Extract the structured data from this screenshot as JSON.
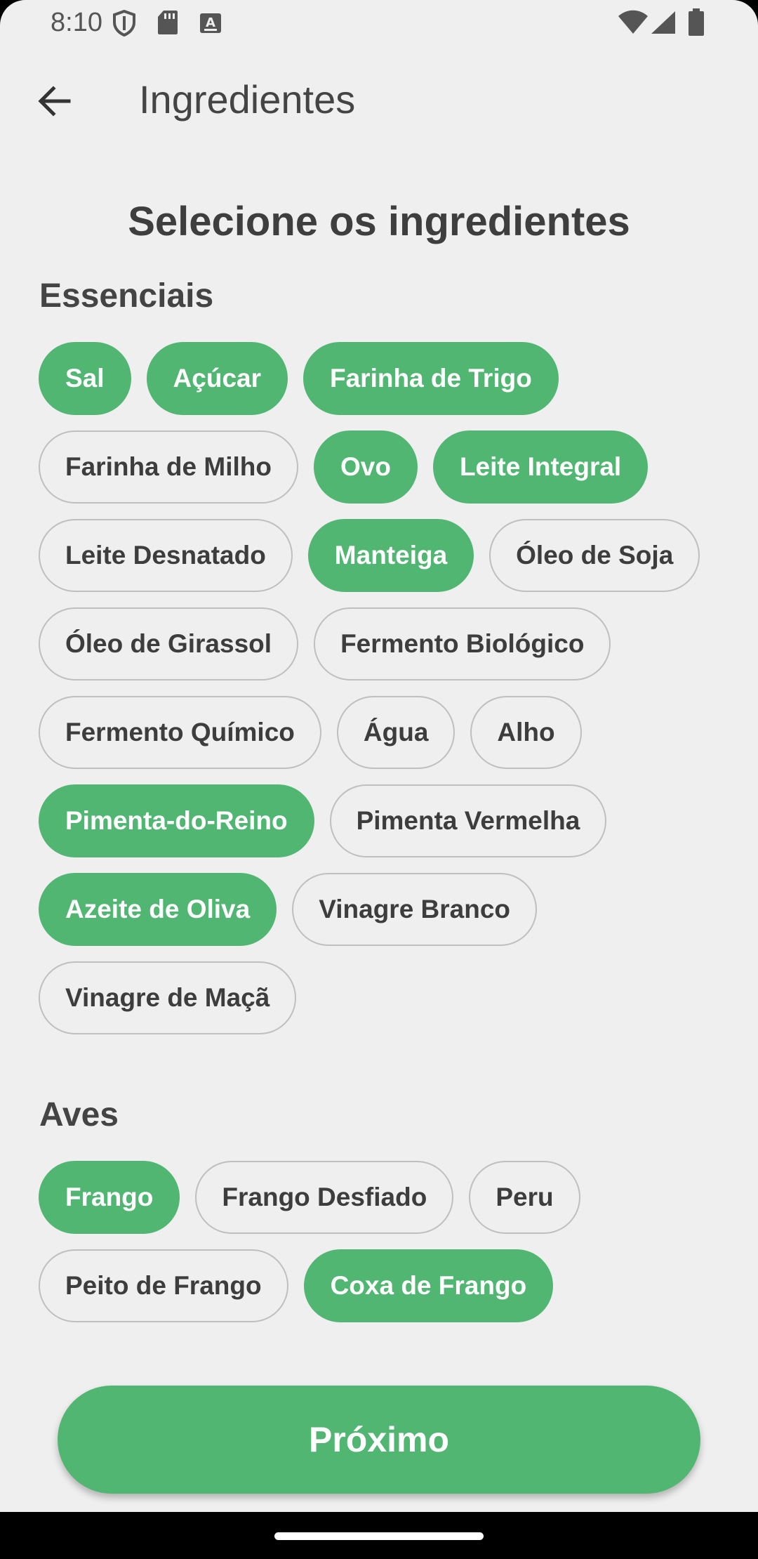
{
  "status_bar": {
    "time": "8:10",
    "icons": [
      "shield-icon",
      "sd-card-icon",
      "keyboard-a-icon",
      "wifi-icon",
      "signal-icon",
      "battery-icon"
    ]
  },
  "app_bar": {
    "back_icon": "arrow-back-icon",
    "title": "Ingredientes"
  },
  "heading": "Selecione os ingredientes",
  "sections": [
    {
      "title": "Essenciais",
      "chips": [
        {
          "label": "Sal",
          "selected": true
        },
        {
          "label": "Açúcar",
          "selected": true
        },
        {
          "label": "Farinha de Trigo",
          "selected": true
        },
        {
          "label": "Farinha de Milho",
          "selected": false
        },
        {
          "label": "Ovo",
          "selected": true
        },
        {
          "label": "Leite Integral",
          "selected": true
        },
        {
          "label": "Leite Desnatado",
          "selected": false
        },
        {
          "label": "Manteiga",
          "selected": true
        },
        {
          "label": "Óleo de Soja",
          "selected": false
        },
        {
          "label": "Óleo de Girassol",
          "selected": false
        },
        {
          "label": "Fermento Biológico",
          "selected": false
        },
        {
          "label": "Fermento Químico",
          "selected": false
        },
        {
          "label": "Água",
          "selected": false
        },
        {
          "label": "Alho",
          "selected": false
        },
        {
          "label": "Pimenta-do-Reino",
          "selected": true
        },
        {
          "label": "Pimenta Vermelha",
          "selected": false
        },
        {
          "label": "Azeite de Oliva",
          "selected": true
        },
        {
          "label": "Vinagre Branco",
          "selected": false
        },
        {
          "label": "Vinagre de Maçã",
          "selected": false
        }
      ]
    },
    {
      "title": "Aves",
      "chips": [
        {
          "label": "Frango",
          "selected": true
        },
        {
          "label": "Frango Desfiado",
          "selected": false
        },
        {
          "label": "Peru",
          "selected": false
        },
        {
          "label": "Peito de Frango",
          "selected": false
        },
        {
          "label": "Coxa de Frango",
          "selected": true
        }
      ]
    }
  ],
  "next_button": {
    "label": "Próximo"
  },
  "colors": {
    "accent": "#52b673",
    "background": "#efefef",
    "chip_border": "#bfbfbf",
    "text": "#3d3d3d"
  }
}
